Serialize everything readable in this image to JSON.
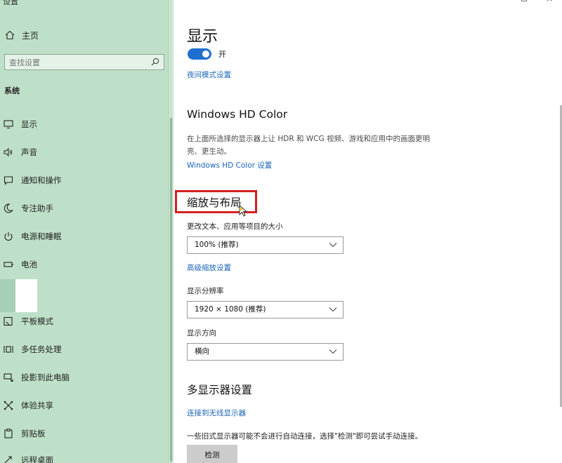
{
  "window": {
    "title": "设置",
    "minimize": "–",
    "maximize": "☐",
    "close": "✕"
  },
  "sidebar": {
    "home_label": "主页",
    "search_placeholder": "查找设置",
    "section_label": "系统",
    "items": [
      {
        "label": "显示",
        "icon": "monitor-icon"
      },
      {
        "label": "声音",
        "icon": "speaker-icon"
      },
      {
        "label": "通知和操作",
        "icon": "notification-icon"
      },
      {
        "label": "专注助手",
        "icon": "moon-icon"
      },
      {
        "label": "电源和睡眠",
        "icon": "power-icon"
      },
      {
        "label": "电池",
        "icon": "battery-icon"
      },
      {
        "label": "平板模式",
        "icon": "tablet-icon"
      },
      {
        "label": "多任务处理",
        "icon": "multitask-icon"
      },
      {
        "label": "投影到此电脑",
        "icon": "project-icon"
      },
      {
        "label": "体验共享",
        "icon": "share-icon"
      },
      {
        "label": "剪贴板",
        "icon": "clipboard-icon"
      },
      {
        "label": "远程桌面",
        "icon": "remote-icon"
      }
    ]
  },
  "main": {
    "title": "显示",
    "toggle_state": "开",
    "night_light_link": "夜间模式设置",
    "hd_color": {
      "heading": "Windows HD Color",
      "description": "在上面所选择的显示器上让 HDR 和 WCG 视频、游戏和应用中的画面更明亮、更生动。",
      "link": "Windows HD Color 设置"
    },
    "scale_layout": {
      "heading": "缩放与布局",
      "scale_label": "更改文本、应用等项目的大小",
      "scale_value": "100% (推荐)",
      "advanced_link": "高级缩放设置",
      "resolution_label": "显示分辨率",
      "resolution_value": "1920 × 1080 (推荐)",
      "orientation_label": "显示方向",
      "orientation_value": "横向"
    },
    "multi_display": {
      "heading": "多显示器设置",
      "wireless_link": "连接到无线显示器",
      "note": "一些旧式显示器可能不会进行自动连接，选择\"检测\"即可尝试手动连接。",
      "detect_button": "检测"
    }
  },
  "colors": {
    "sidebar_bg": "#bfe0c8",
    "accent": "#1f6fd0",
    "link": "#1a64b8",
    "highlight": "#d42020"
  }
}
